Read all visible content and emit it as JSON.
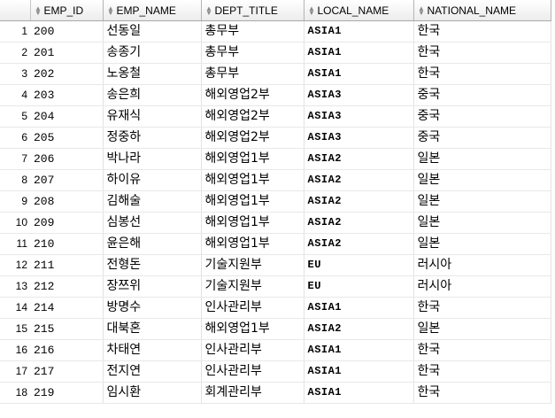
{
  "columns": {
    "emp_id": "EMP_ID",
    "emp_name": "EMP_NAME",
    "dept_title": "DEPT_TITLE",
    "local_name": "LOCAL_NAME",
    "national_name": "NATIONAL_NAME"
  },
  "rows": [
    {
      "num": "1",
      "emp_id": "200",
      "emp_name": "선동일",
      "dept_title": "총무부",
      "local_name": "ASIA1",
      "national_name": "한국"
    },
    {
      "num": "2",
      "emp_id": "201",
      "emp_name": "송종기",
      "dept_title": "총무부",
      "local_name": "ASIA1",
      "national_name": "한국"
    },
    {
      "num": "3",
      "emp_id": "202",
      "emp_name": "노옹철",
      "dept_title": "총무부",
      "local_name": "ASIA1",
      "national_name": "한국"
    },
    {
      "num": "4",
      "emp_id": "203",
      "emp_name": "송은희",
      "dept_title": "해외영업2부",
      "local_name": "ASIA3",
      "national_name": "중국"
    },
    {
      "num": "5",
      "emp_id": "204",
      "emp_name": "유재식",
      "dept_title": "해외영업2부",
      "local_name": "ASIA3",
      "national_name": "중국"
    },
    {
      "num": "6",
      "emp_id": "205",
      "emp_name": "정중하",
      "dept_title": "해외영업2부",
      "local_name": "ASIA3",
      "national_name": "중국"
    },
    {
      "num": "7",
      "emp_id": "206",
      "emp_name": "박나라",
      "dept_title": "해외영업1부",
      "local_name": "ASIA2",
      "national_name": "일본"
    },
    {
      "num": "8",
      "emp_id": "207",
      "emp_name": "하이유",
      "dept_title": "해외영업1부",
      "local_name": "ASIA2",
      "national_name": "일본"
    },
    {
      "num": "9",
      "emp_id": "208",
      "emp_name": "김해술",
      "dept_title": "해외영업1부",
      "local_name": "ASIA2",
      "national_name": "일본"
    },
    {
      "num": "10",
      "emp_id": "209",
      "emp_name": "심봉선",
      "dept_title": "해외영업1부",
      "local_name": "ASIA2",
      "national_name": "일본"
    },
    {
      "num": "11",
      "emp_id": "210",
      "emp_name": "윤은해",
      "dept_title": "해외영업1부",
      "local_name": "ASIA2",
      "national_name": "일본"
    },
    {
      "num": "12",
      "emp_id": "211",
      "emp_name": "전형돈",
      "dept_title": "기술지원부",
      "local_name": "EU",
      "national_name": "러시아"
    },
    {
      "num": "13",
      "emp_id": "212",
      "emp_name": "장쯔위",
      "dept_title": "기술지원부",
      "local_name": "EU",
      "national_name": "러시아"
    },
    {
      "num": "14",
      "emp_id": "214",
      "emp_name": "방명수",
      "dept_title": "인사관리부",
      "local_name": "ASIA1",
      "national_name": "한국"
    },
    {
      "num": "15",
      "emp_id": "215",
      "emp_name": "대북혼",
      "dept_title": "해외영업1부",
      "local_name": "ASIA2",
      "national_name": "일본"
    },
    {
      "num": "16",
      "emp_id": "216",
      "emp_name": "차태연",
      "dept_title": "인사관리부",
      "local_name": "ASIA1",
      "national_name": "한국"
    },
    {
      "num": "17",
      "emp_id": "217",
      "emp_name": "전지연",
      "dept_title": "인사관리부",
      "local_name": "ASIA1",
      "national_name": "한국"
    },
    {
      "num": "18",
      "emp_id": "219",
      "emp_name": "임시환",
      "dept_title": "회계관리부",
      "local_name": "ASIA1",
      "national_name": "한국"
    }
  ]
}
